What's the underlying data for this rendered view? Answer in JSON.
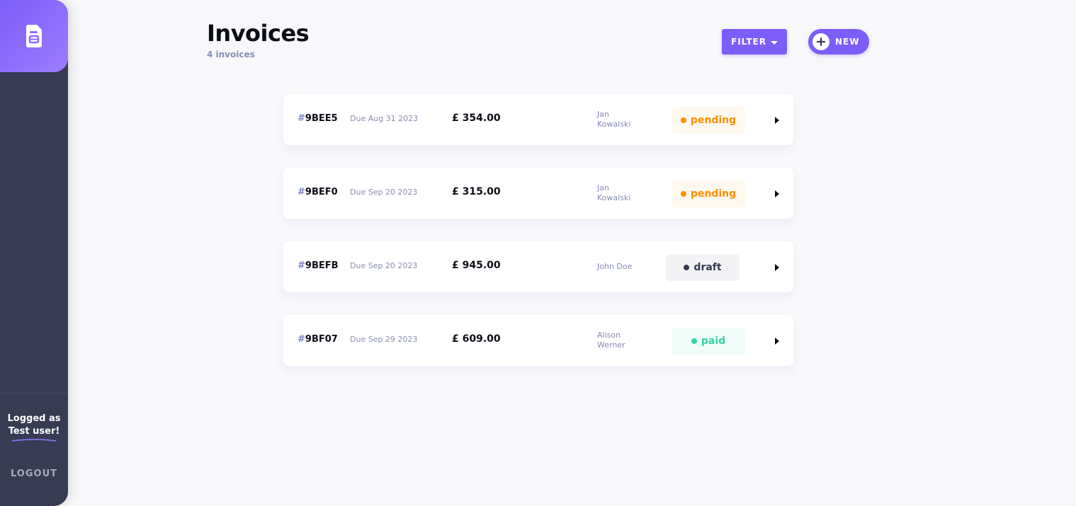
{
  "sidebar": {
    "logged_as_line1": "Logged as",
    "logged_as_line2": "Test user!",
    "logout_label": "LOGOUT",
    "logo_icon": "document-icon",
    "accent_color": "#7c5dfa"
  },
  "header": {
    "title": "Invoices",
    "subtitle": "4 invoices",
    "filter_label": "FILTER",
    "new_label": "NEW"
  },
  "invoices": [
    {
      "hash": "#",
      "id": "9BEE5",
      "due": "Due Aug 31 2023",
      "amount": "£ 354.00",
      "client_line1": "Jan",
      "client_line2": "Kowalski",
      "status": "pending"
    },
    {
      "hash": "#",
      "id": "9BEF0",
      "due": "Due Sep 20 2023",
      "amount": "£ 315.00",
      "client_line1": "Jan",
      "client_line2": "Kowalski",
      "status": "pending"
    },
    {
      "hash": "#",
      "id": "9BEFB",
      "due": "Due Sep 20 2023",
      "amount": "£ 945.00",
      "client_line1": "John Doe",
      "client_line2": "",
      "status": "draft"
    },
    {
      "hash": "#",
      "id": "9BF07",
      "due": "Due Sep 29 2023",
      "amount": "£ 609.00",
      "client_line1": "Alison",
      "client_line2": "Werner",
      "status": "paid"
    }
  ],
  "status_colors": {
    "pending": "#ff8f00",
    "draft": "#373b53",
    "paid": "#33d69f"
  }
}
